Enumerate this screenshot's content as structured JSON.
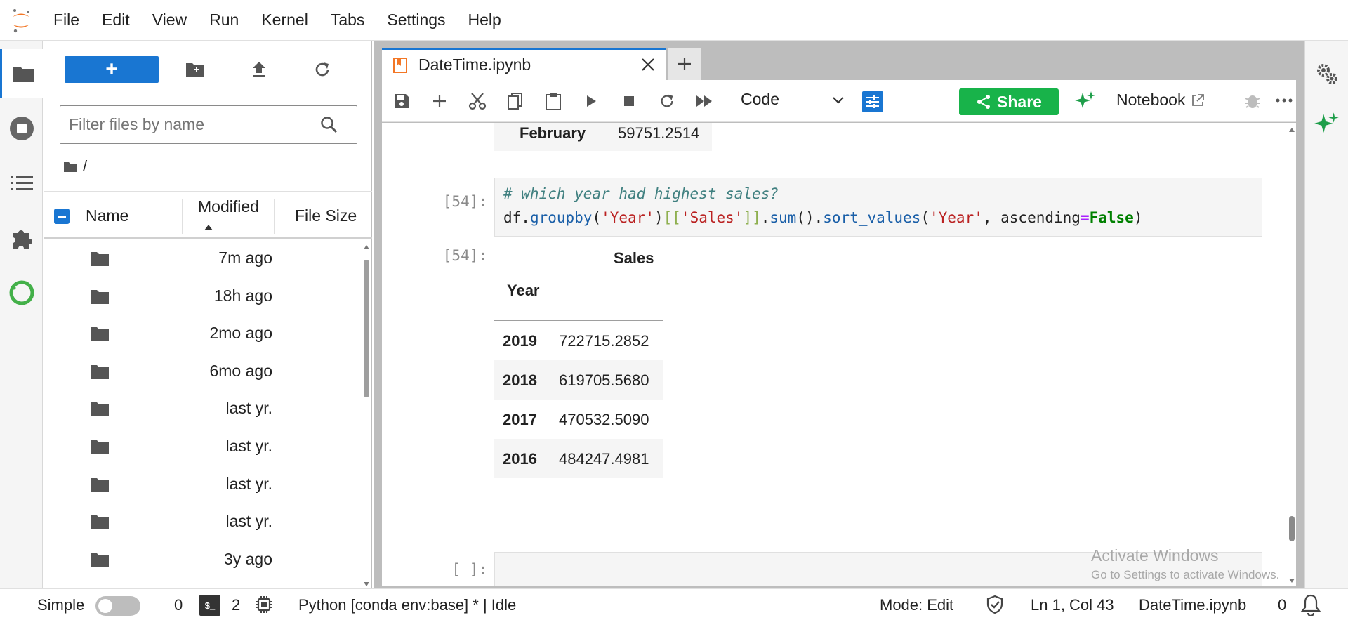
{
  "menubar": {
    "items": [
      "File",
      "Edit",
      "View",
      "Run",
      "Kernel",
      "Tabs",
      "Settings",
      "Help"
    ]
  },
  "activitybar": {
    "icons": [
      "folder-icon",
      "running-stop-icon",
      "table-of-contents-icon",
      "extension-puzzle-icon",
      "conda-env-icon"
    ]
  },
  "filebrowser": {
    "new_label": "+",
    "filter_placeholder": "Filter files by name",
    "breadcrumb": "/",
    "columns": {
      "name": "Name",
      "modified": "Modified",
      "size": "File Size"
    },
    "rows": [
      {
        "modified": "7m ago"
      },
      {
        "modified": "18h ago"
      },
      {
        "modified": "2mo ago"
      },
      {
        "modified": "6mo ago"
      },
      {
        "modified": "last yr."
      },
      {
        "modified": "last yr."
      },
      {
        "modified": "last yr."
      },
      {
        "modified": "last yr."
      },
      {
        "modified": "3y ago"
      }
    ]
  },
  "tabs": [
    {
      "title": "DateTime.ipynb"
    }
  ],
  "toolbar": {
    "cell_type": "Code",
    "share_label": "Share",
    "notebook_label": "Notebook"
  },
  "notebook": {
    "prev_output": {
      "month": "February",
      "value": "59751.2514"
    },
    "cell": {
      "in_prompt": "[54]:",
      "out_prompt": "[54]:",
      "comment": "# which year had highest sales?",
      "code": {
        "t1": "df.",
        "t2": "groupby",
        "t3": "(",
        "t4": "'Year'",
        "t5": ")",
        "t6": "[[",
        "t7": "'Sales'",
        "t8": "]]",
        "t9": ".",
        "t10": "sum",
        "t11": "().",
        "t12": "sort_values",
        "t13": "(",
        "t14": "'Year'",
        "t15": ", ascending",
        "t16": "=",
        "t17": "False",
        "t18": ")"
      }
    },
    "output_table": {
      "column": "Sales",
      "index_name": "Year",
      "rows": [
        {
          "year": "2019",
          "sales": "722715.2852"
        },
        {
          "year": "2018",
          "sales": "619705.5680"
        },
        {
          "year": "2017",
          "sales": "470532.5090"
        },
        {
          "year": "2016",
          "sales": "484247.4981"
        }
      ]
    },
    "empty_prompt": "[ ]:"
  },
  "watermark": {
    "line1": "Activate Windows",
    "line2": "Go to Settings to activate Windows."
  },
  "statusbar": {
    "mode_label": "Simple",
    "terminals_count": "0",
    "terminal_icon_text": "$_",
    "kernels_count": "2",
    "kernel": "Python [conda env:base] * | Idle",
    "mode": "Mode: Edit",
    "cursor": "Ln 1, Col 43",
    "filename": "DateTime.ipynb",
    "notifications": "0"
  },
  "colors": {
    "accent": "#1976d2",
    "share_green": "#18b34a",
    "jupyter_orange": "#f37726",
    "conda_green": "#43b049"
  }
}
